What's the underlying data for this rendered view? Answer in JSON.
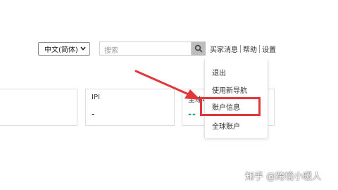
{
  "header": {
    "language_select": "中文(简体)",
    "search_placeholder": "搜索",
    "nav": {
      "buyer_messages": "买家消息",
      "help": "帮助",
      "settings": "设置"
    }
  },
  "cards": [
    {
      "label": "",
      "value": ""
    },
    {
      "label": "IPI",
      "value": "-"
    },
    {
      "label": "全球收入",
      "value": "--"
    }
  ],
  "dropdown": {
    "items": [
      "退出",
      "使用新导航",
      "账户信息",
      "全球账户"
    ],
    "highlighted": "账户信息"
  },
  "annotation": {
    "arrow_color": "#e0383a",
    "box_color": "#e0383a"
  },
  "watermark": "知乎 @跨境小暖人"
}
